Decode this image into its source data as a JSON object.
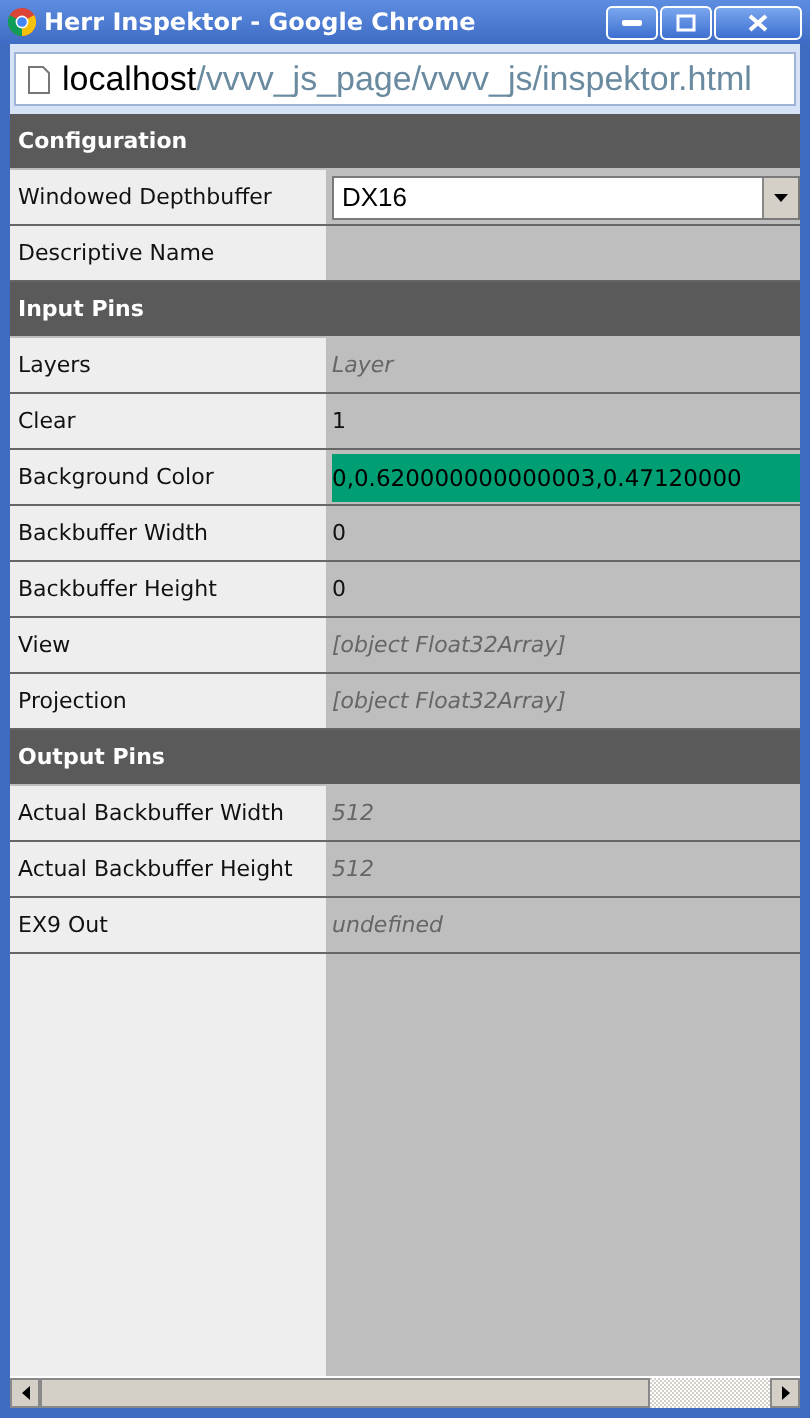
{
  "window": {
    "title": "Herr Inspektor - Google Chrome"
  },
  "address": {
    "host": "localhost",
    "path": "/vvvv_js_page/vvvv_js/inspektor.html"
  },
  "sections": [
    {
      "title": "Configuration",
      "rows": [
        {
          "label": "Windowed Depthbuffer",
          "kind": "select",
          "value": "DX16"
        },
        {
          "label": "Descriptive Name",
          "kind": "empty"
        }
      ]
    },
    {
      "title": "Input Pins",
      "rows": [
        {
          "label": "Layers",
          "kind": "placeholder",
          "value": "Layer"
        },
        {
          "label": "Clear",
          "kind": "text",
          "value": "1"
        },
        {
          "label": "Background Color",
          "kind": "color",
          "value": "0,0.620000000000003,0.47120000",
          "color": "#009e73"
        },
        {
          "label": "Backbuffer Width",
          "kind": "text",
          "value": "0"
        },
        {
          "label": "Backbuffer Height",
          "kind": "text",
          "value": "0"
        },
        {
          "label": "View",
          "kind": "placeholder",
          "value": "[object Float32Array]"
        },
        {
          "label": "Projection",
          "kind": "placeholder",
          "value": "[object Float32Array]"
        }
      ]
    },
    {
      "title": "Output Pins",
      "rows": [
        {
          "label": "Actual Backbuffer Width",
          "kind": "placeholder",
          "value": "512"
        },
        {
          "label": "Actual Backbuffer Height",
          "kind": "placeholder",
          "value": "512"
        },
        {
          "label": "EX9 Out",
          "kind": "placeholder",
          "value": "undefined"
        }
      ]
    }
  ]
}
